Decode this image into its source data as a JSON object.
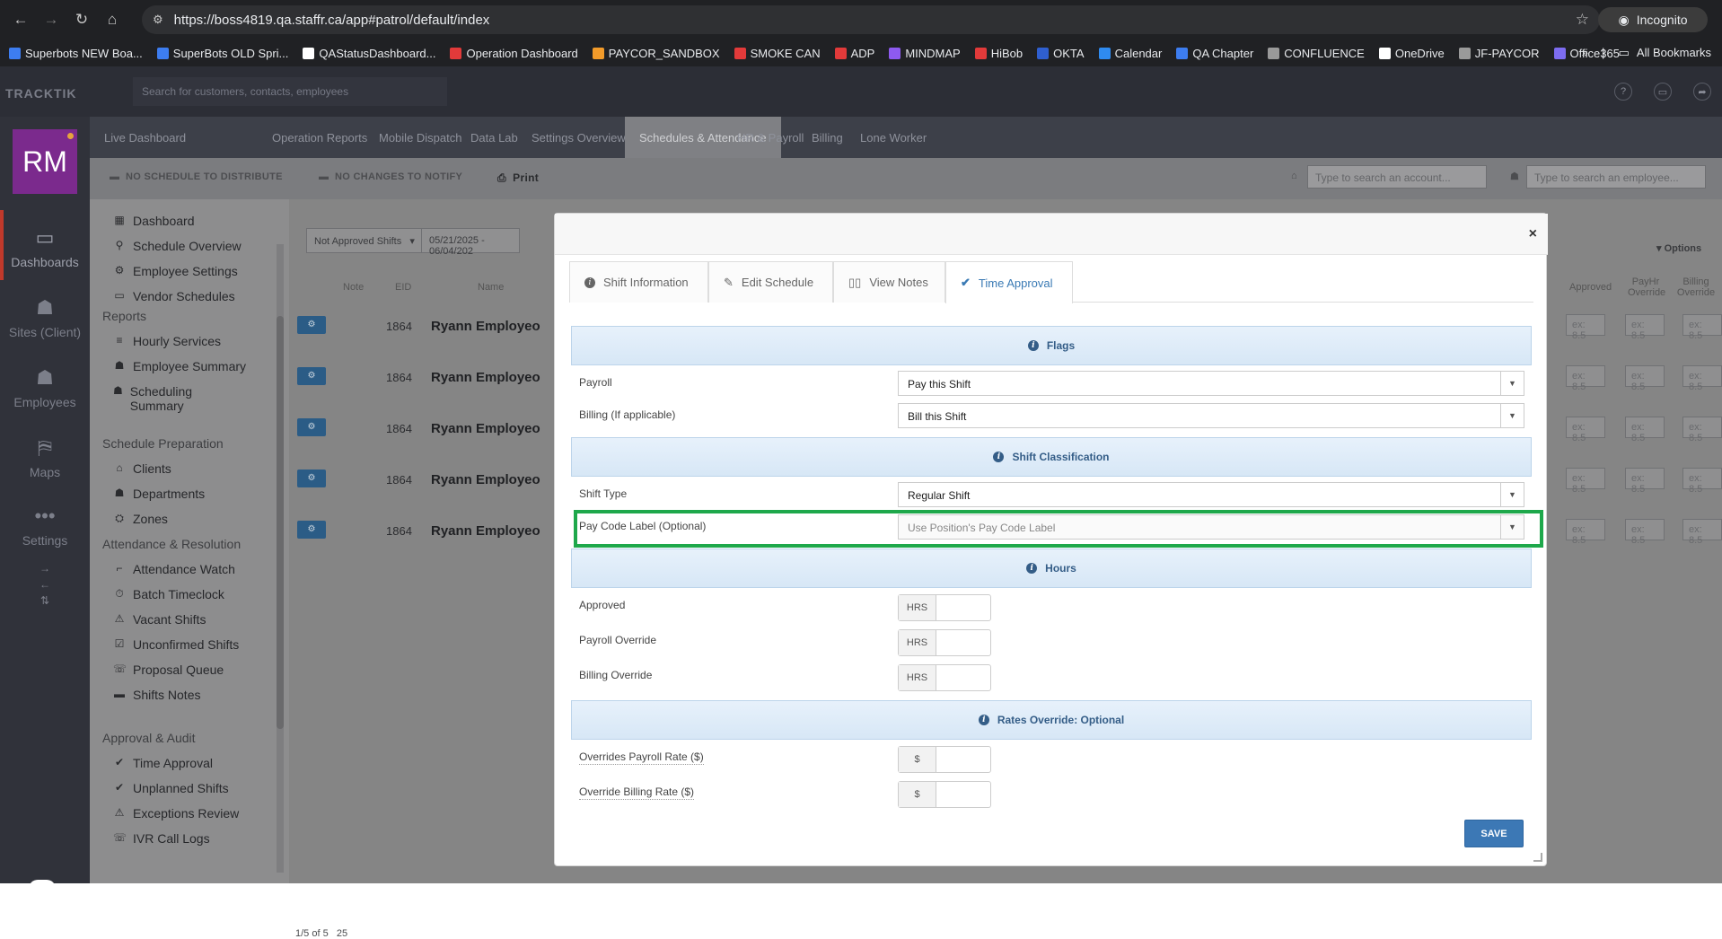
{
  "browser": {
    "url": "https://boss4819.qa.staffr.ca/app#patrol/default/index",
    "incognito_label": "Incognito",
    "all_bookmarks": "All Bookmarks",
    "bookmarks": [
      {
        "label": "Superbots NEW Boa...",
        "color": "#3d7df0"
      },
      {
        "label": "SuperBots OLD Spri...",
        "color": "#3d7df0"
      },
      {
        "label": "QAStatusDashboard...",
        "color": "#ffffff"
      },
      {
        "label": "Operation Dashboard",
        "color": "#e23a3a"
      },
      {
        "label": "PAYCOR_SANDBOX",
        "color": "#f29b2a"
      },
      {
        "label": "SMOKE CAN",
        "color": "#e23a3a"
      },
      {
        "label": "ADP",
        "color": "#e23a3a"
      },
      {
        "label": "MINDMAP",
        "color": "#8e5af0"
      },
      {
        "label": "HiBob",
        "color": "#e23a3a"
      },
      {
        "label": "OKTA",
        "color": "#2f5fd0"
      },
      {
        "label": "Calendar",
        "color": "#2f8bf0"
      },
      {
        "label": "QA Chapter",
        "color": "#3d7df0"
      },
      {
        "label": "CONFLUENCE",
        "color": "#9a9a9a"
      },
      {
        "label": "OneDrive",
        "color": "#ffffff"
      },
      {
        "label": "JF-PAYCOR",
        "color": "#9a9a9a"
      },
      {
        "label": "Office365",
        "color": "#7d6cf0"
      }
    ]
  },
  "app": {
    "logo": "TRACKTIK",
    "search_placeholder": "Search for customers, contacts, employees",
    "avatar_initials": "RM",
    "left_nav": [
      "Dashboards",
      "Sites (Client)",
      "Employees",
      "Maps",
      "Settings"
    ],
    "tabs": [
      "Live Dashboard",
      "Operation Reports",
      "Mobile Dispatch",
      "Data Lab",
      "Settings Overview",
      "Schedules & Attendance",
      "HR & Payroll",
      "Billing",
      "Lone Worker"
    ],
    "toolbar": {
      "no_schedule": "NO SCHEDULE TO DISTRIBUTE",
      "no_changes": "NO CHANGES TO NOTIFY",
      "print": "Print",
      "account_search": "Type to search an account...",
      "employee_search": "Type to search an employee..."
    }
  },
  "sidebar": {
    "top_items": [
      "Dashboard",
      "Schedule Overview",
      "Employee Settings",
      "Vendor Schedules"
    ],
    "reports_head": "Reports",
    "reports": [
      "Hourly Services",
      "Employee Summary",
      "Scheduling Summary"
    ],
    "prep_head": "Schedule Preparation",
    "prep": [
      "Clients",
      "Departments",
      "Zones"
    ],
    "attendance_head": "Attendance & Resolution",
    "attendance": [
      "Attendance Watch",
      "Batch Timeclock",
      "Vacant Shifts",
      "Unconfirmed Shifts",
      "Proposal Queue",
      "Shifts Notes"
    ],
    "approval_head": "Approval & Audit",
    "approval": [
      "Time Approval",
      "Unplanned Shifts",
      "Exceptions Review",
      "IVR Call Logs"
    ]
  },
  "grid": {
    "filter": "Not Approved Shifts",
    "date_range": "05/21/2025 - 06/04/202",
    "options": "Options",
    "columns": [
      "Note",
      "EID",
      "Name",
      "Approved",
      "PayHr Override",
      "Billing Override"
    ],
    "rows": [
      {
        "eid": "1864",
        "name": "Ryann Employeo"
      },
      {
        "eid": "1864",
        "name": "Ryann Employeo"
      },
      {
        "eid": "1864",
        "name": "Ryann Employeo"
      },
      {
        "eid": "1864",
        "name": "Ryann Employeo"
      },
      {
        "eid": "1864",
        "name": "Ryann Employeo"
      }
    ],
    "input_placeholder": "ex: 8.5",
    "pager_text": "1/5 of 5",
    "page_size": "25"
  },
  "modal": {
    "close": "×",
    "tabs": [
      "Shift Information",
      "Edit Schedule",
      "View Notes",
      "Time Approval"
    ],
    "flags_title": "Flags",
    "payroll_label": "Payroll",
    "payroll_value": "Pay this Shift",
    "billing_label": "Billing (If applicable)",
    "billing_value": "Bill this Shift",
    "classification_title": "Shift Classification",
    "shift_type_label": "Shift Type",
    "shift_type_value": "Regular Shift",
    "pay_code_label": "Pay Code Label (Optional)",
    "pay_code_value": "Use Position's Pay Code Label",
    "hours_title": "Hours",
    "approved_label": "Approved",
    "payroll_override_label": "Payroll Override",
    "billing_override_label": "Billing Override",
    "hrs_addon": "HRS",
    "rates_title": "Rates Override: Optional",
    "payroll_rate_label": "Overrides Payroll Rate ($)",
    "billing_rate_label": "Override Billing Rate ($)",
    "currency_addon": "$",
    "save_label": "SAVE",
    "highlight_color": "#1ea84b",
    "accent_color": "#3c78b5"
  }
}
